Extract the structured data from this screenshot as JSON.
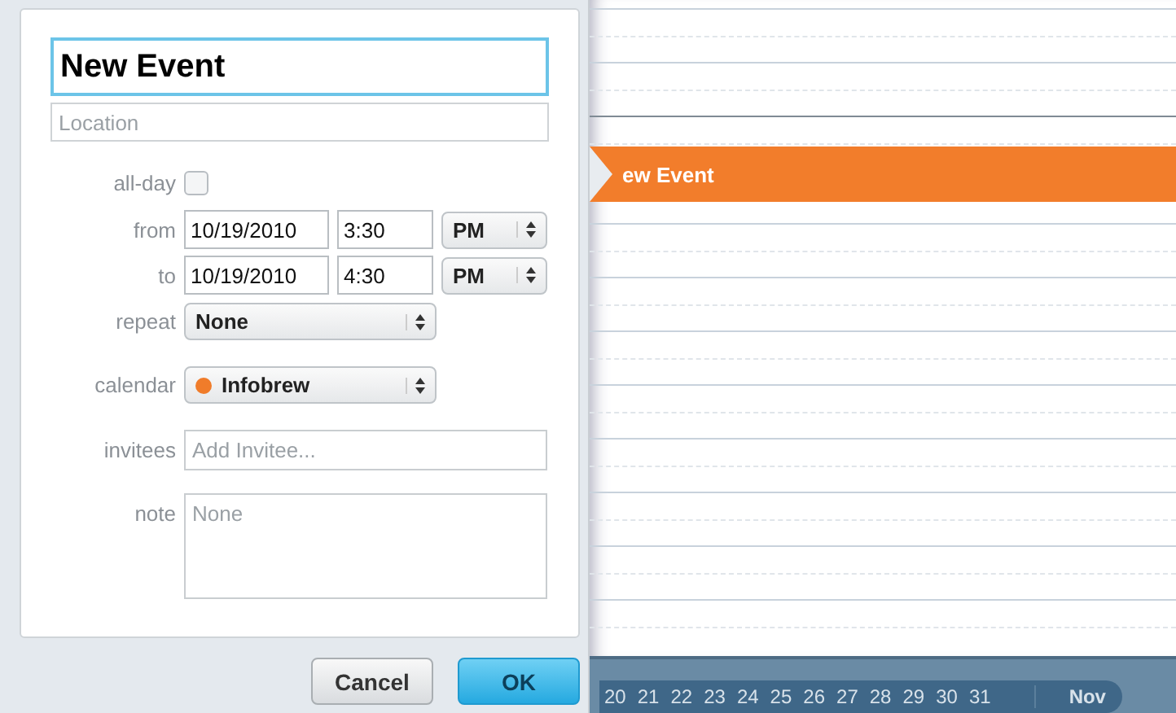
{
  "event_editor": {
    "title": "New Event",
    "location": {
      "placeholder": "Location"
    },
    "all_day": {
      "label": "all-day",
      "checked": false
    },
    "from": {
      "label": "from",
      "date": "10/19/2010",
      "time": "3:30",
      "period": "PM"
    },
    "to": {
      "label": "to",
      "date": "10/19/2010",
      "time": "4:30",
      "period": "PM"
    },
    "repeat": {
      "label": "repeat",
      "value": "None"
    },
    "calendar": {
      "label": "calendar",
      "value": "Infobrew",
      "color": "#f07c2a"
    },
    "invitees": {
      "label": "invitees",
      "placeholder": "Add Invitee..."
    },
    "note": {
      "label": "note",
      "placeholder": "None"
    },
    "buttons": [
      {
        "label": "Cancel",
        "kind": "cancel"
      },
      {
        "label": "OK",
        "kind": "default"
      }
    ]
  },
  "day_view": {
    "event": {
      "title": "ew Event",
      "color": "#f27d2b"
    },
    "date_strip": {
      "days": [
        "20",
        "21",
        "22",
        "23",
        "24",
        "25",
        "26",
        "27",
        "28",
        "29",
        "30",
        "31"
      ],
      "month": "Nov"
    }
  }
}
